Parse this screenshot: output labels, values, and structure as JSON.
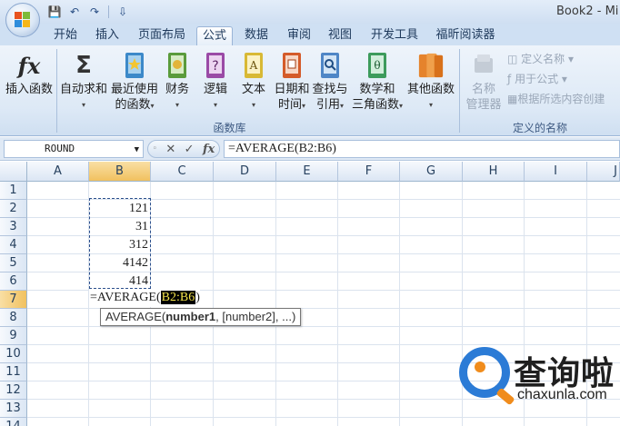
{
  "window": {
    "title": "Book2 - Mi"
  },
  "quick_access": {
    "save": "💾",
    "undo": "↶",
    "redo": "↷",
    "customize": "⇩"
  },
  "tabs": [
    "开始",
    "插入",
    "页面布局",
    "公式",
    "数据",
    "审阅",
    "视图",
    "开发工具",
    "福昕阅读器"
  ],
  "active_tab": "公式",
  "ribbon": {
    "function_library": {
      "label": "函数库",
      "items": [
        {
          "label": "插入函数",
          "icon": "fx-icon"
        },
        {
          "label": "自动求和",
          "icon": "sigma-icon"
        },
        {
          "label": "最近使用",
          "label2": "的函数",
          "icon": "star-book-icon"
        },
        {
          "label": "财务",
          "icon": "finance-book-icon"
        },
        {
          "label": "逻辑",
          "icon": "logic-book-icon"
        },
        {
          "label": "文本",
          "icon": "text-book-icon"
        },
        {
          "label": "日期和",
          "label2": "时间",
          "icon": "datetime-book-icon"
        },
        {
          "label": "查找与",
          "label2": "引用",
          "icon": "lookup-book-icon"
        },
        {
          "label": "数学和",
          "label2": "三角函数",
          "icon": "math-book-icon"
        },
        {
          "label": "其他函数",
          "icon": "more-books-icon"
        }
      ]
    },
    "defined_names": {
      "label": "定义的名称",
      "name_manager": "名称",
      "name_manager2": "管理器",
      "define_name": "定义名称",
      "use_in_formula": "用于公式",
      "create_from_selection": "根据所选内容创建"
    }
  },
  "formula_bar": {
    "name_box": "ROUND",
    "cancel": "✕",
    "enter": "✓",
    "fx": "fx",
    "formula": "=AVERAGE(B2:B6)"
  },
  "grid": {
    "columns": [
      "A",
      "B",
      "C",
      "D",
      "E",
      "F",
      "G",
      "H",
      "I",
      "J"
    ],
    "rows": [
      "1",
      "2",
      "3",
      "4",
      "5",
      "6",
      "7",
      "8",
      "9",
      "10",
      "11",
      "12",
      "13",
      "14"
    ],
    "values_b": [
      {
        "row": "2",
        "value": "121"
      },
      {
        "row": "3",
        "value": "31"
      },
      {
        "row": "4",
        "value": "312"
      },
      {
        "row": "5",
        "value": "4142"
      },
      {
        "row": "6",
        "value": "414"
      }
    ],
    "editing_cell": {
      "prefix": "=AVERAGE(",
      "ref": "B2:B6",
      "suffix": ")"
    },
    "tooltip": {
      "func": "AVERAGE(",
      "arg1": "number1",
      "rest": ", [number2], ...)"
    }
  },
  "watermark": {
    "cn": "查询啦",
    "en": "chaxunla.com"
  },
  "colors": {
    "accent_orange": "#f08c1c",
    "accent_blue": "#2b7bd6",
    "ribbon_blue": "#dde9f6"
  }
}
